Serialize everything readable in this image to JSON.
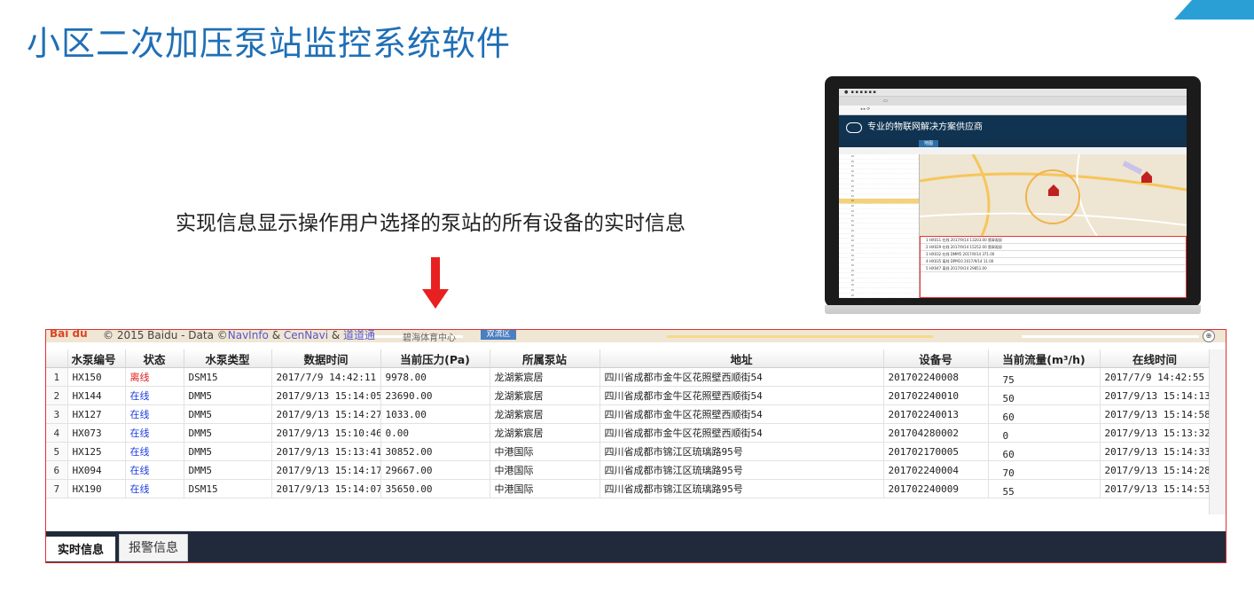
{
  "page": {
    "title": "小区二次加压泵站监控系统软件",
    "subtitle": "实现信息显示操作用户选择的泵站的所有设备的实时信息"
  },
  "colors": {
    "title": "#1f6fb6",
    "panel_border": "#e03030",
    "offline": "#e02020",
    "online": "#1f3ee0",
    "tab_bar": "#212a3b",
    "arrow": "#e82020"
  },
  "monitor": {
    "header_title": "专业的物联网解决方案供应商",
    "nav_tab": "地图",
    "tree_items": 34,
    "tree_selected_index": 9,
    "mini_rows": [
      "1  HX011  在线  2017/9/14  13203.00  翡翠观邸",
      "2  HX029  在线  2017/9/14  15252.00  翡翠观邸",
      "3  HX032  在线  DMM5  2017/9/14  371.00",
      "4  HX035  离线  DPM10  2017/9/14  11.00",
      "5  HX047  离线  2017/9/14  29851.00"
    ]
  },
  "map_strip": {
    "logo": "Bai du",
    "copyright": "© 2015 Baidu - Data ©",
    "provider1": "NavInfo",
    "amp1": " & ",
    "provider2": "CenNavi",
    "amp2": " & ",
    "provider3": "道道通",
    "place_label": "碧海体育中心",
    "badge": "双流区"
  },
  "grid": {
    "headers": [
      "",
      "水泵编号",
      "状态",
      "水泵类型",
      "数据时间",
      "当前压力(Pa)",
      "所属泵站",
      "地址",
      "设备号",
      "当前流量(m³/h)",
      "在线时间"
    ],
    "rows": [
      [
        "1",
        "HX150",
        "离线",
        "DSM15",
        "2017/7/9 14:42:11",
        "9978.00",
        "龙湖紫宸居",
        "四川省成都市金牛区花照壁西顺街54",
        "201702240008",
        "75",
        "2017/7/9 14:42:55"
      ],
      [
        "2",
        "HX144",
        "在线",
        "DMM5",
        "2017/9/13 15:14:05",
        "23690.00",
        "龙湖紫宸居",
        "四川省成都市金牛区花照壁西顺街54",
        "201702240010",
        "50",
        "2017/9/13 15:14:13"
      ],
      [
        "3",
        "HX127",
        "在线",
        "DMM5",
        "2017/9/13 15:14:27",
        "1033.00",
        "龙湖紫宸居",
        "四川省成都市金牛区花照壁西顺街54",
        "201702240013",
        "60",
        "2017/9/13 15:14:58"
      ],
      [
        "4",
        "HX073",
        "在线",
        "DMM5",
        "2017/9/13 15:10:46",
        "0.00",
        "龙湖紫宸居",
        "四川省成都市金牛区花照壁西顺街54",
        "201704280002",
        "0",
        "2017/9/13 15:13:32"
      ],
      [
        "5",
        "HX125",
        "在线",
        "DMM5",
        "2017/9/13 15:13:41",
        "30852.00",
        "中港国际",
        "四川省成都市锦江区琉璃路95号",
        "201702170005",
        "60",
        "2017/9/13 15:14:33"
      ],
      [
        "6",
        "HX094",
        "在线",
        "DMM5",
        "2017/9/13 15:14:17",
        "29667.00",
        "中港国际",
        "四川省成都市锦江区琉璃路95号",
        "201702240004",
        "70",
        "2017/9/13 15:14:28"
      ],
      [
        "7",
        "HX190",
        "在线",
        "DSM15",
        "2017/9/13 15:14:07",
        "35650.00",
        "中港国际",
        "四川省成都市锦江区琉璃路95号",
        "201702240009",
        "55",
        "2017/9/13 15:14:53"
      ]
    ]
  },
  "tabs": {
    "realtime": "实时信息",
    "alarm": "报警信息"
  }
}
